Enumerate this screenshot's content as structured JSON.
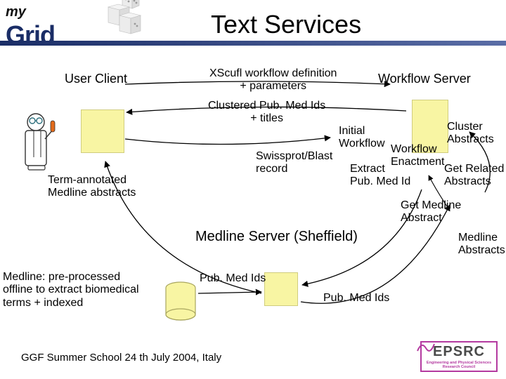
{
  "logo": {
    "part1": "my",
    "part2": "Grid"
  },
  "title": "Text Services",
  "labels": {
    "user_client": "User Client",
    "xscufl": "XScufl workflow definition\n+ parameters",
    "workflow_server": "Workflow Server",
    "clustered": "Clustered Pub. Med Ids\n+ titles",
    "swissprot": "Swissprot/Blast\nrecord",
    "initial_workflow": "Initial\nWorkflow",
    "extract": "Extract\nPub. Med Id",
    "workflow_enactment": "Workflow\nEnactment",
    "cluster_abstracts": "Cluster\nAbstracts",
    "get_related": "Get Related\nAbstracts",
    "get_medline_abstract": "Get Medline\nAbstract",
    "medline_abstracts": "Medline\nAbstracts",
    "pubmed_ids_left": "Pub. Med Ids",
    "pubmed_ids_right": "Pub. Med Ids",
    "medline_server": "Medline Server (Sheffield)",
    "term_annotated": "Term-annotated\nMedline abstracts",
    "medline_note": "Medline: pre-processed\noffline to extract biomedical\nterms + indexed"
  },
  "footer": "GGF Summer School 24 th July 2004, Italy",
  "epsrc": {
    "title": "EPSRC",
    "sub": "Engineering and Physical Sciences\nResearch Council"
  }
}
